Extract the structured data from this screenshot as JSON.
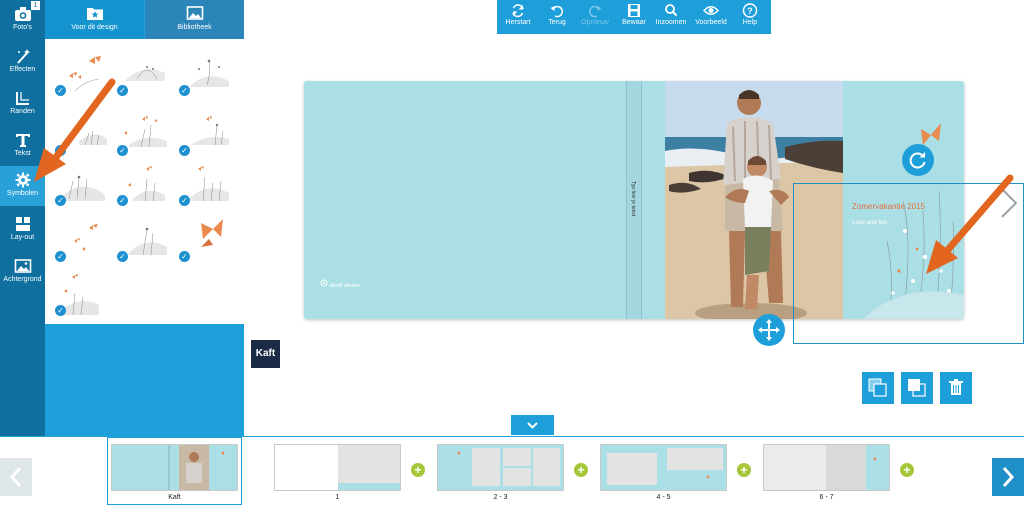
{
  "sidebar": {
    "photo_count": "1",
    "items": [
      {
        "label": "Foto's",
        "icon": "camera-icon"
      },
      {
        "label": "Effecten",
        "icon": "magic-wand-icon"
      },
      {
        "label": "Randen",
        "icon": "border-icon"
      },
      {
        "label": "Tekst",
        "icon": "text-icon"
      },
      {
        "label": "Symbolen",
        "icon": "gear-icon"
      },
      {
        "label": "Lay-out",
        "icon": "layout-icon"
      },
      {
        "label": "Achtergrond",
        "icon": "image-icon"
      }
    ],
    "active": "Symbolen"
  },
  "panel": {
    "tabs": [
      {
        "label": "Voor dit design",
        "icon": "star-folder-icon"
      },
      {
        "label": "Bibliotheek",
        "icon": "picture-icon"
      }
    ],
    "active_tab": "Voor dit design",
    "symbols": [
      "butterflies-flowers-1",
      "flowers-2",
      "flowers-3",
      "butterflies-grass-4",
      "butterflies-flowers-5",
      "flowers-6",
      "flowers-7",
      "butterflies-flowers-8",
      "flowers-9",
      "butterflies-10",
      "flowers-11",
      "butterfly-12",
      "flowers-13"
    ]
  },
  "toolbar": {
    "buttons": [
      {
        "label": "Herstart",
        "icon": "refresh-icon",
        "enabled": true
      },
      {
        "label": "Terug",
        "icon": "undo-icon",
        "enabled": true
      },
      {
        "label": "Opnieuw",
        "icon": "redo-icon",
        "enabled": false
      },
      {
        "label": "Bewaar",
        "icon": "save-icon",
        "enabled": true
      },
      {
        "label": "Inzoomen",
        "icon": "search-icon",
        "enabled": true
      },
      {
        "label": "Voorbeeld",
        "icon": "eye-icon",
        "enabled": true
      },
      {
        "label": "Help",
        "icon": "help-icon",
        "enabled": true
      }
    ]
  },
  "cover": {
    "title": "Zomervakantie 2015",
    "subtitle": "Love and fun",
    "spine_text": "Typ hier je tekst",
    "logo_text": "albelli albums",
    "page_label": "Kaft"
  },
  "filmstrip": {
    "pages": [
      "Kaft",
      "1",
      "2 - 3",
      "4 - 5",
      "6 - 7"
    ]
  },
  "colors": {
    "accent": "#1f9fd9",
    "sidebar": "#0f6f9f",
    "cover": "#abdfe6",
    "butterfly": "#e98a4f",
    "arrow": "#e2661f",
    "add": "#a7c73a"
  }
}
